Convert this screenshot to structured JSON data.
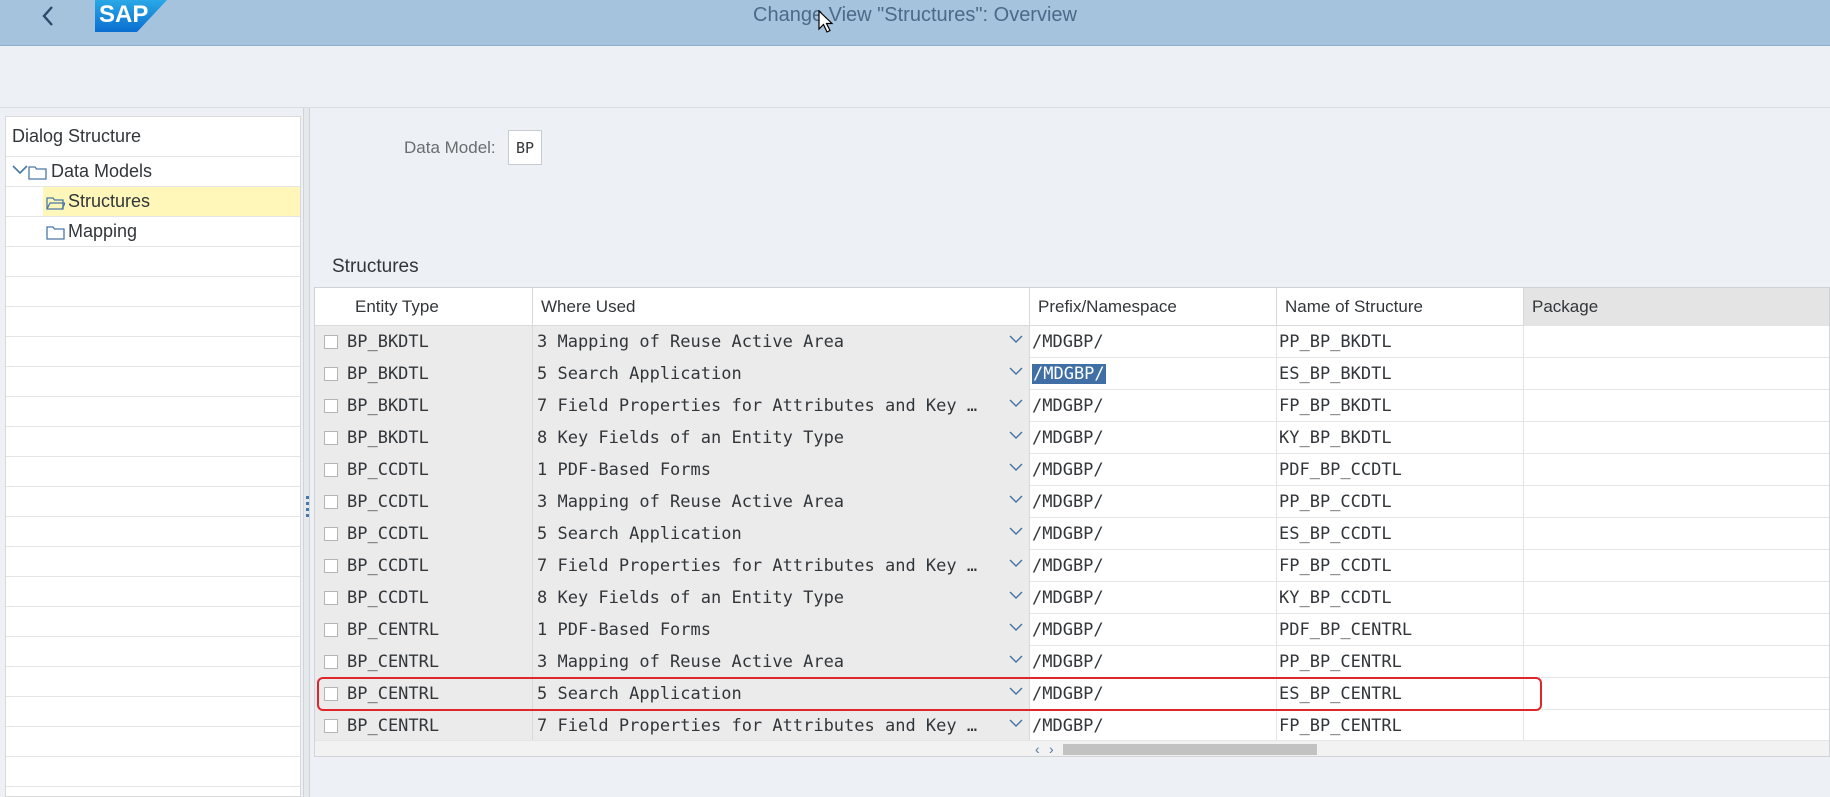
{
  "titlebar": {
    "title": "Change View \"Structures\": Overview",
    "logo_text": "SAP",
    "back_icon": "chevron-left-icon"
  },
  "dialog_structure": {
    "header": "Dialog Structure",
    "items": [
      {
        "label": "Data Models",
        "level": 0,
        "expanded": true,
        "icon": "folder-icon"
      },
      {
        "label": "Structures",
        "level": 1,
        "selected": true,
        "icon": "folder-open-icon"
      },
      {
        "label": "Mapping",
        "level": 1,
        "icon": "folder-icon"
      }
    ]
  },
  "data_model": {
    "label": "Data Model:",
    "value": "BP"
  },
  "structures": {
    "title": "Structures",
    "columns": [
      "Entity Type",
      "Where Used",
      "Prefix/Namespace",
      "Name of Structure",
      "Package"
    ],
    "rows": [
      {
        "entity_type": "BP_BKDTL",
        "where_used": "3 Mapping of Reuse Active Area",
        "prefix": "/MDGBP/",
        "name": "PP_BP_BKDTL",
        "package": ""
      },
      {
        "entity_type": "BP_BKDTL",
        "where_used": "5 Search Application",
        "prefix": "/MDGBP/",
        "name": "ES_BP_BKDTL",
        "package": ""
      },
      {
        "entity_type": "BP_BKDTL",
        "where_used": "7 Field Properties for Attributes and Key …",
        "prefix": "/MDGBP/",
        "name": "FP_BP_BKDTL",
        "package": ""
      },
      {
        "entity_type": "BP_BKDTL",
        "where_used": "8 Key Fields of an Entity Type",
        "prefix": "/MDGBP/",
        "name": "KY_BP_BKDTL",
        "package": ""
      },
      {
        "entity_type": "BP_CCDTL",
        "where_used": "1 PDF-Based Forms",
        "prefix": "/MDGBP/",
        "name": "PDF_BP_CCDTL",
        "package": ""
      },
      {
        "entity_type": "BP_CCDTL",
        "where_used": "3 Mapping of Reuse Active Area",
        "prefix": "/MDGBP/",
        "name": "PP_BP_CCDTL",
        "package": ""
      },
      {
        "entity_type": "BP_CCDTL",
        "where_used": "5 Search Application",
        "prefix": "/MDGBP/",
        "name": "ES_BP_CCDTL",
        "package": ""
      },
      {
        "entity_type": "BP_CCDTL",
        "where_used": "7 Field Properties for Attributes and Key …",
        "prefix": "/MDGBP/",
        "name": "FP_BP_CCDTL",
        "package": ""
      },
      {
        "entity_type": "BP_CCDTL",
        "where_used": "8 Key Fields of an Entity Type",
        "prefix": "/MDGBP/",
        "name": "KY_BP_CCDTL",
        "package": ""
      },
      {
        "entity_type": "BP_CENTRL",
        "where_used": "1 PDF-Based Forms",
        "prefix": "/MDGBP/",
        "name": "PDF_BP_CENTRL",
        "package": ""
      },
      {
        "entity_type": "BP_CENTRL",
        "where_used": "3 Mapping of Reuse Active Area",
        "prefix": "/MDGBP/",
        "name": "PP_BP_CENTRL",
        "package": ""
      },
      {
        "entity_type": "BP_CENTRL",
        "where_used": "5 Search Application",
        "prefix": "/MDGBP/",
        "name": "ES_BP_CENTRL",
        "package": ""
      },
      {
        "entity_type": "BP_CENTRL",
        "where_used": "7 Field Properties for Attributes and Key …",
        "prefix": "/MDGBP/",
        "name": "FP_BP_CENTRL",
        "package": ""
      }
    ],
    "selected_text_row": 1,
    "highlighted_row": 11
  },
  "colors": {
    "titlebar_bg": "#a6c3dd",
    "selection_bg": "#fef7b9",
    "highlight_border": "#e0252b",
    "text_selection": "#3f6fa5"
  }
}
